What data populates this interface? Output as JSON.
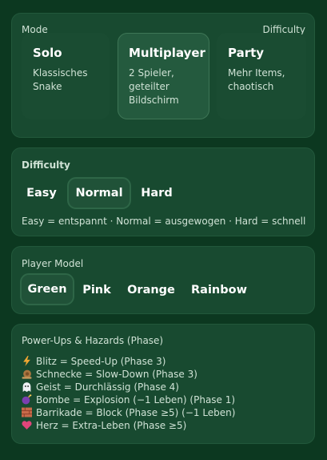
{
  "mode": {
    "label": "Mode",
    "difficulty_hint": "Difficulty",
    "options": [
      {
        "title": "Solo",
        "desc": "Klassisches Snake",
        "selected": false
      },
      {
        "title": "Multiplayer",
        "desc": "2 Spieler, geteilter Bildschirm",
        "selected": true
      },
      {
        "title": "Party",
        "desc": "Mehr Items, chaotisch",
        "selected": false
      }
    ]
  },
  "difficulty": {
    "label": "Difficulty",
    "options": [
      "Easy",
      "Normal",
      "Hard"
    ],
    "selected": "Normal",
    "note": "Easy = entspannt · Normal = ausgewogen · Hard = schnell"
  },
  "player_model": {
    "label": "Player Model",
    "options": [
      "Green",
      "Pink",
      "Orange",
      "Rainbow"
    ],
    "selected": "Green"
  },
  "powerups": {
    "label": "Power-Ups & Hazards (Phase)",
    "items": [
      {
        "icon": "lightning-icon",
        "text": "Blitz = Speed-Up (Phase 3)"
      },
      {
        "icon": "snail-icon",
        "text": "Schnecke = Slow-Down (Phase 3)"
      },
      {
        "icon": "ghost-icon",
        "text": "Geist = Durchlässig (Phase 4)"
      },
      {
        "icon": "bomb-icon",
        "text": "Bombe = Explosion (−1 Leben) (Phase 1)"
      },
      {
        "icon": "brick-icon",
        "text": "Barrikade = Block (Phase ≥5) (−1 Leben)"
      },
      {
        "icon": "heart-icon",
        "text": "Herz = Extra-Leben (Phase ≥5)"
      }
    ]
  },
  "colors": {
    "background": "#0c3820",
    "card": "#184a30",
    "selected": "#245a3e"
  }
}
